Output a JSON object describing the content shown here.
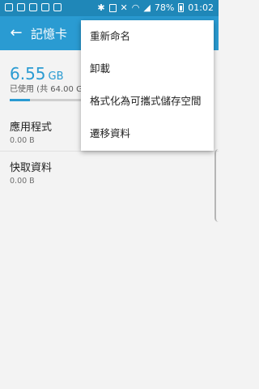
{
  "status_bar": {
    "battery": "78%",
    "time": "01:02"
  },
  "app_bar": {
    "back_icon": "arrow-left",
    "title": "記憶卡"
  },
  "storage": {
    "size_value": "6.55",
    "size_unit": "GB",
    "used_text": "已使用 (共 64.00 G",
    "used_fraction": 0.1
  },
  "items": [
    {
      "name": "應用程式",
      "value": "0.00 B"
    },
    {
      "name": "快取資料",
      "value": "0.00 B"
    }
  ],
  "menu": {
    "items": [
      "重新命名",
      "卸載",
      "格式化為可攜式儲存空間",
      "遷移資料"
    ]
  },
  "colors": {
    "accent": "#2a9bd2",
    "status_bar": "#1f87b8"
  }
}
